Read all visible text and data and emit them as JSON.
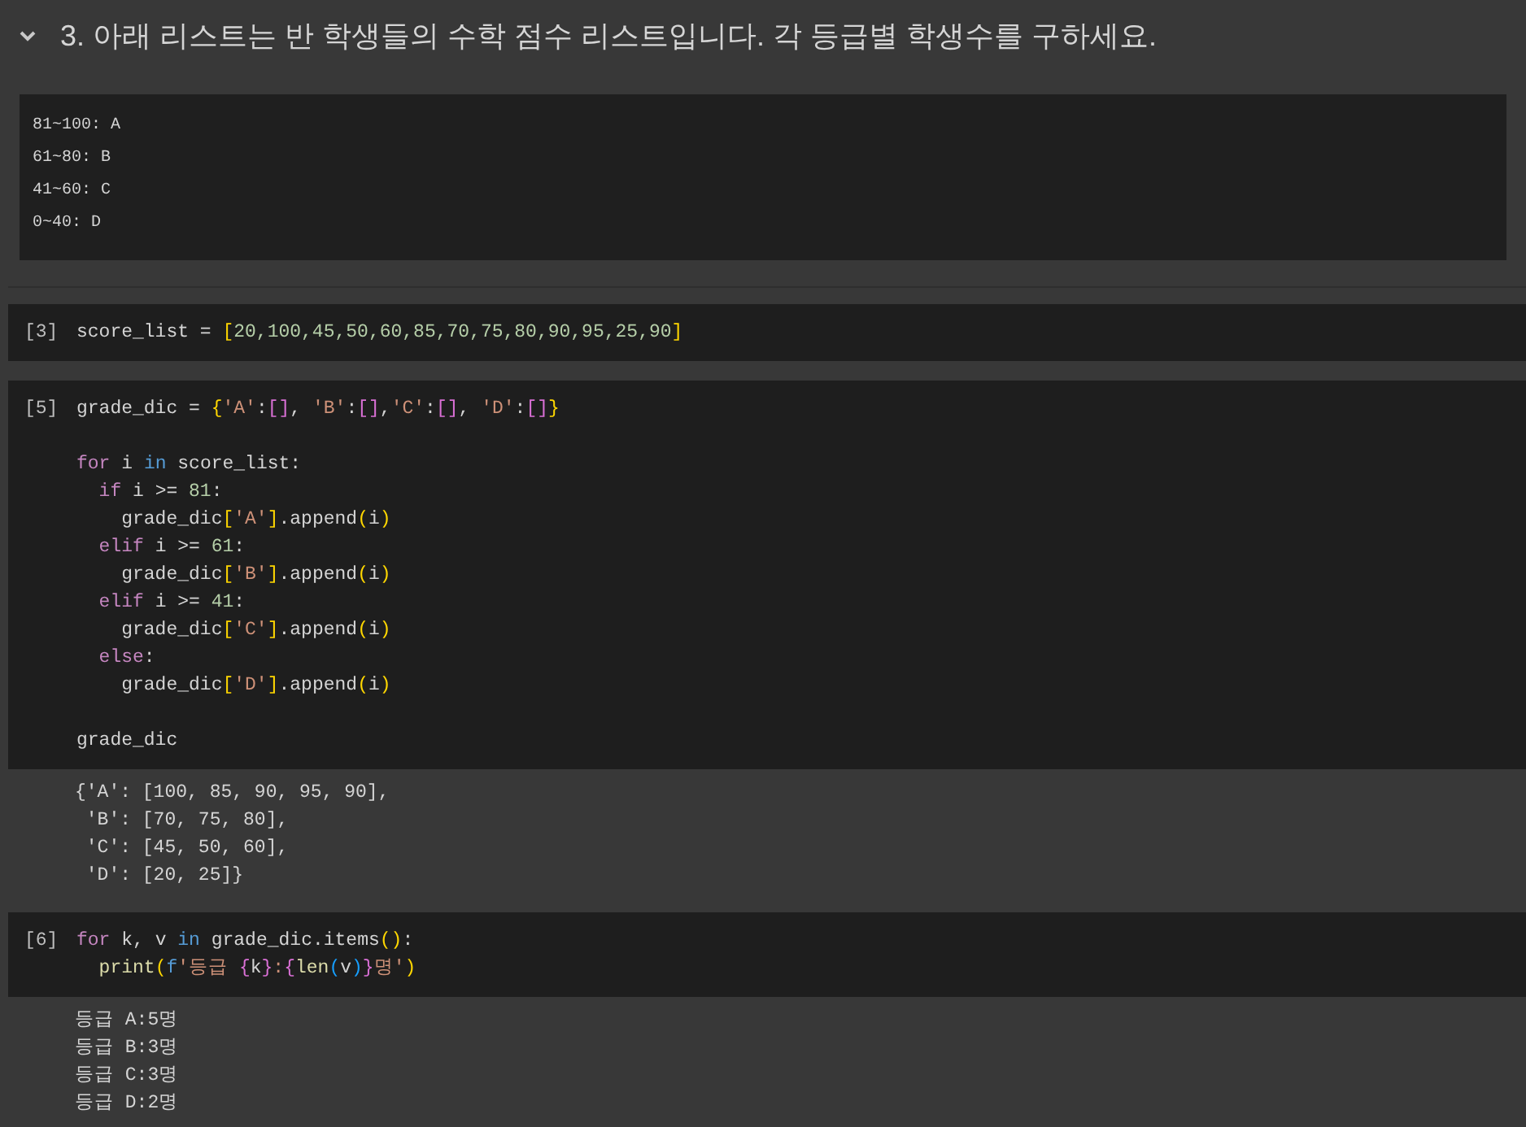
{
  "cells": [
    {
      "kind": "markdown",
      "expanded": true,
      "heading": "3. 아래 리스트는 반 학생들의 수학 점수 리스트입니다. 각 등급별 학생수를 구하세요.",
      "pre_lines": [
        "81~100: A",
        "61~80: B",
        "41~60: C",
        "0~40: D"
      ]
    },
    {
      "kind": "code",
      "exec_count": "[3]",
      "lines": [
        {
          "kind": "code",
          "tokens": [
            {
              "t": "score_list = ",
              "kind": "plain"
            },
            {
              "t": "[",
              "kind": "b1"
            },
            {
              "t": "20,100,45,50,60,85,70,75,80,90,95,25,90",
              "kind": "number"
            },
            {
              "t": "]",
              "kind": "b1"
            }
          ]
        }
      ]
    },
    {
      "kind": "code",
      "exec_count": "[5]",
      "lines": [
        {
          "kind": "code",
          "tokens": [
            {
              "t": "grade_dic = ",
              "kind": "plain"
            },
            {
              "t": "{",
              "kind": "b1"
            },
            {
              "t": "'A'",
              "kind": "string"
            },
            {
              "t": ":",
              "kind": "plain"
            },
            {
              "t": "[]",
              "kind": "b2"
            },
            {
              "t": ", ",
              "kind": "plain"
            },
            {
              "t": "'B'",
              "kind": "string"
            },
            {
              "t": ":",
              "kind": "plain"
            },
            {
              "t": "[]",
              "kind": "b2"
            },
            {
              "t": ",",
              "kind": "plain"
            },
            {
              "t": "'C'",
              "kind": "string"
            },
            {
              "t": ":",
              "kind": "plain"
            },
            {
              "t": "[]",
              "kind": "b2"
            },
            {
              "t": ", ",
              "kind": "plain"
            },
            {
              "t": "'D'",
              "kind": "string"
            },
            {
              "t": ":",
              "kind": "plain"
            },
            {
              "t": "[]",
              "kind": "b2"
            },
            {
              "t": "}",
              "kind": "b1"
            }
          ]
        },
        {
          "kind": "blank"
        },
        {
          "kind": "code",
          "tokens": [
            {
              "t": "for",
              "kind": "keyword"
            },
            {
              "t": " i ",
              "kind": "plain"
            },
            {
              "t": "in",
              "kind": "operator"
            },
            {
              "t": " score_list:",
              "kind": "plain"
            }
          ]
        },
        {
          "kind": "code",
          "tokens": [
            {
              "t": "  if",
              "kind": "keyword"
            },
            {
              "t": " i >= ",
              "kind": "plain"
            },
            {
              "t": "81",
              "kind": "number"
            },
            {
              "t": ":",
              "kind": "plain"
            }
          ]
        },
        {
          "kind": "code",
          "tokens": [
            {
              "t": "    grade_dic",
              "kind": "plain"
            },
            {
              "t": "[",
              "kind": "b1"
            },
            {
              "t": "'A'",
              "kind": "string"
            },
            {
              "t": "]",
              "kind": "b1"
            },
            {
              "t": ".append",
              "kind": "plain"
            },
            {
              "t": "(",
              "kind": "b1"
            },
            {
              "t": "i",
              "kind": "plain"
            },
            {
              "t": ")",
              "kind": "b1"
            }
          ]
        },
        {
          "kind": "code",
          "tokens": [
            {
              "t": "  elif",
              "kind": "keyword"
            },
            {
              "t": " i >= ",
              "kind": "plain"
            },
            {
              "t": "61",
              "kind": "number"
            },
            {
              "t": ":",
              "kind": "plain"
            }
          ]
        },
        {
          "kind": "code",
          "tokens": [
            {
              "t": "    grade_dic",
              "kind": "plain"
            },
            {
              "t": "[",
              "kind": "b1"
            },
            {
              "t": "'B'",
              "kind": "string"
            },
            {
              "t": "]",
              "kind": "b1"
            },
            {
              "t": ".append",
              "kind": "plain"
            },
            {
              "t": "(",
              "kind": "b1"
            },
            {
              "t": "i",
              "kind": "plain"
            },
            {
              "t": ")",
              "kind": "b1"
            }
          ]
        },
        {
          "kind": "code",
          "tokens": [
            {
              "t": "  elif",
              "kind": "keyword"
            },
            {
              "t": " i >= ",
              "kind": "plain"
            },
            {
              "t": "41",
              "kind": "number"
            },
            {
              "t": ":",
              "kind": "plain"
            }
          ]
        },
        {
          "kind": "code",
          "tokens": [
            {
              "t": "    grade_dic",
              "kind": "plain"
            },
            {
              "t": "[",
              "kind": "b1"
            },
            {
              "t": "'C'",
              "kind": "string"
            },
            {
              "t": "]",
              "kind": "b1"
            },
            {
              "t": ".append",
              "kind": "plain"
            },
            {
              "t": "(",
              "kind": "b1"
            },
            {
              "t": "i",
              "kind": "plain"
            },
            {
              "t": ")",
              "kind": "b1"
            }
          ]
        },
        {
          "kind": "code",
          "tokens": [
            {
              "t": "  else",
              "kind": "keyword"
            },
            {
              "t": ":",
              "kind": "plain"
            }
          ]
        },
        {
          "kind": "code",
          "tokens": [
            {
              "t": "    grade_dic",
              "kind": "plain"
            },
            {
              "t": "[",
              "kind": "b1"
            },
            {
              "t": "'D'",
              "kind": "string"
            },
            {
              "t": "]",
              "kind": "b1"
            },
            {
              "t": ".append",
              "kind": "plain"
            },
            {
              "t": "(",
              "kind": "b1"
            },
            {
              "t": "i",
              "kind": "plain"
            },
            {
              "t": ")",
              "kind": "b1"
            }
          ]
        },
        {
          "kind": "blank"
        },
        {
          "kind": "code",
          "tokens": [
            {
              "t": "grade_dic",
              "kind": "plain"
            }
          ]
        }
      ],
      "output": [
        "{'A': [100, 85, 90, 95, 90],",
        " 'B': [70, 75, 80],",
        " 'C': [45, 50, 60],",
        " 'D': [20, 25]}"
      ]
    },
    {
      "kind": "code",
      "exec_count": "[6]",
      "lines": [
        {
          "kind": "code",
          "tokens": [
            {
              "t": "for",
              "kind": "keyword"
            },
            {
              "t": " k, v ",
              "kind": "plain"
            },
            {
              "t": "in",
              "kind": "operator"
            },
            {
              "t": " grade_dic.items",
              "kind": "plain"
            },
            {
              "t": "()",
              "kind": "b1"
            },
            {
              "t": ":",
              "kind": "plain"
            }
          ]
        },
        {
          "kind": "code",
          "tokens": [
            {
              "t": "  print",
              "kind": "function"
            },
            {
              "t": "(",
              "kind": "b1"
            },
            {
              "t": "f",
              "kind": "operator"
            },
            {
              "t": "'등급 ",
              "kind": "string"
            },
            {
              "t": "{",
              "kind": "b2"
            },
            {
              "t": "k",
              "kind": "plain"
            },
            {
              "t": "}",
              "kind": "b2"
            },
            {
              "t": ":",
              "kind": "string"
            },
            {
              "t": "{",
              "kind": "b2"
            },
            {
              "t": "len",
              "kind": "function"
            },
            {
              "t": "(",
              "kind": "b3"
            },
            {
              "t": "v",
              "kind": "plain"
            },
            {
              "t": ")",
              "kind": "b3"
            },
            {
              "t": "}",
              "kind": "b2"
            },
            {
              "t": "명'",
              "kind": "string"
            },
            {
              "t": ")",
              "kind": "b1"
            }
          ]
        }
      ],
      "output": [
        "등급 A:5명",
        "등급 B:3명",
        "등급 C:3명",
        "등급 D:2명"
      ]
    }
  ]
}
